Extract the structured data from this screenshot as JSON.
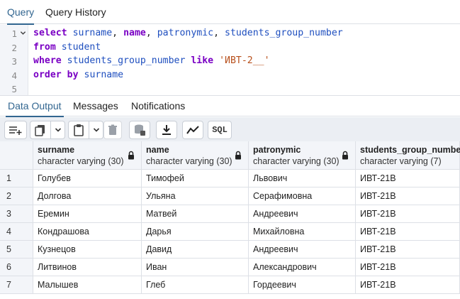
{
  "top_tabs": [
    "Query",
    "Query History"
  ],
  "editor": {
    "line_numbers": [
      "1",
      "2",
      "3",
      "4",
      "5"
    ],
    "lines": [
      [
        {
          "t": "select",
          "c": "kw"
        },
        {
          "t": " ",
          "c": ""
        },
        {
          "t": "surname",
          "c": "id"
        },
        {
          "t": ", ",
          "c": ""
        },
        {
          "t": "name",
          "c": "kw"
        },
        {
          "t": ", ",
          "c": ""
        },
        {
          "t": "patronymic",
          "c": "id"
        },
        {
          "t": ", ",
          "c": ""
        },
        {
          "t": "students_group_number",
          "c": "id"
        }
      ],
      [
        {
          "t": "from",
          "c": "kw"
        },
        {
          "t": " ",
          "c": ""
        },
        {
          "t": "student",
          "c": "id"
        }
      ],
      [
        {
          "t": "where",
          "c": "kw"
        },
        {
          "t": " ",
          "c": ""
        },
        {
          "t": "students_group_number",
          "c": "id"
        },
        {
          "t": " ",
          "c": ""
        },
        {
          "t": "like",
          "c": "kw"
        },
        {
          "t": " ",
          "c": ""
        },
        {
          "t": "'ИВТ-2__'",
          "c": "str"
        }
      ],
      [
        {
          "t": "order",
          "c": "kw"
        },
        {
          "t": " ",
          "c": ""
        },
        {
          "t": "by",
          "c": "kw"
        },
        {
          "t": " ",
          "c": ""
        },
        {
          "t": "surname",
          "c": "id"
        }
      ],
      []
    ]
  },
  "output_tabs": [
    "Data Output",
    "Messages",
    "Notifications"
  ],
  "toolbar": {
    "sql_label": "SQL"
  },
  "columns": [
    {
      "name": "surname",
      "type": "character varying (30)"
    },
    {
      "name": "name",
      "type": "character varying (30)"
    },
    {
      "name": "patronymic",
      "type": "character varying (30)"
    },
    {
      "name": "students_group_number",
      "type": "character varying (7)"
    }
  ],
  "rows": [
    {
      "n": "1",
      "cells": [
        "Голубев",
        "Тимофей",
        "Львович",
        "ИВТ-21В"
      ]
    },
    {
      "n": "2",
      "cells": [
        "Долгова",
        "Ульяна",
        "Серафимовна",
        "ИВТ-21В"
      ]
    },
    {
      "n": "3",
      "cells": [
        "Еремин",
        "Матвей",
        "Андреевич",
        "ИВТ-21В"
      ]
    },
    {
      "n": "4",
      "cells": [
        "Кондрашова",
        "Дарья",
        "Михайловна",
        "ИВТ-21В"
      ]
    },
    {
      "n": "5",
      "cells": [
        "Кузнецов",
        "Давид",
        "Андреевич",
        "ИВТ-21В"
      ]
    },
    {
      "n": "6",
      "cells": [
        "Литвинов",
        "Иван",
        "Александрович",
        "ИВТ-21В"
      ]
    },
    {
      "n": "7",
      "cells": [
        "Малышев",
        "Глеб",
        "Гордеевич",
        "ИВТ-21В"
      ]
    }
  ]
}
